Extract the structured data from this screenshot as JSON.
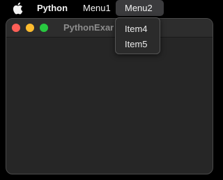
{
  "menubar": {
    "apple_icon": "apple-logo-icon",
    "app_name": "Python",
    "menus": [
      "Menu1",
      "Menu2"
    ],
    "active_menu": "Menu2"
  },
  "window": {
    "title": "PythonExar",
    "traffic_lights": {
      "close_color": "#ff5f57",
      "minimize_color": "#febc2e",
      "maximize_color": "#28c840"
    }
  },
  "dropdown": {
    "items": [
      "Item4",
      "Item5"
    ]
  }
}
